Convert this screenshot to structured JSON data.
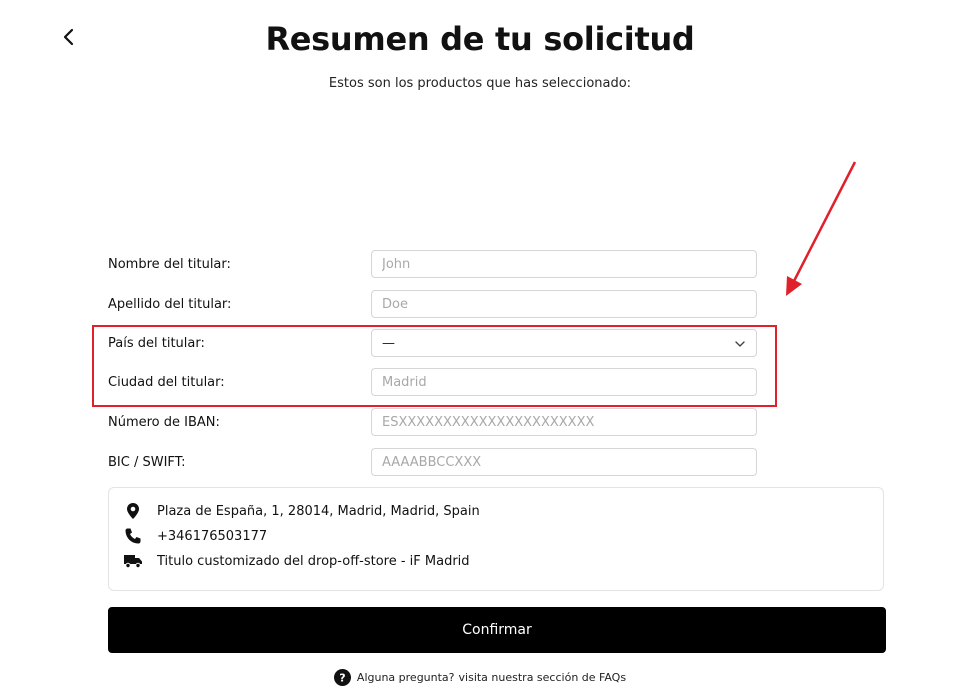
{
  "header": {
    "back_icon": "chevron-left-icon",
    "title": "Resumen de tu solicitud",
    "subtitle": "Estos son los productos que has seleccionado:"
  },
  "form": {
    "fields": [
      {
        "label": "Nombre del titular:",
        "placeholder": "John",
        "value": ""
      },
      {
        "label": "Apellido del titular:",
        "placeholder": "Doe",
        "value": ""
      },
      {
        "label": "País del titular:",
        "selected": "—",
        "icon": "chevron-down-icon"
      },
      {
        "label": "Ciudad del titular:",
        "placeholder": "Madrid",
        "value": ""
      },
      {
        "label": "Número de IBAN:",
        "placeholder": "ESXXXXXXXXXXXXXXXXXXXXXX",
        "value": ""
      },
      {
        "label": "BIC / SWIFT:",
        "placeholder": "AAAABBCCXXX",
        "value": ""
      }
    ]
  },
  "store": {
    "address": "Plaza de España, 1, 28014, Madrid, Madrid, Spain",
    "phone": "+346176503177",
    "name": "Titulo customizado del drop-off-store - iF Madrid",
    "icons": [
      "location-pin-icon",
      "phone-icon",
      "truck-icon"
    ]
  },
  "actions": {
    "confirm_label": "Confirmar"
  },
  "faq": {
    "question": "Alguna pregunta?",
    "link_text": "visita nuestra sección de FAQs"
  },
  "colors": {
    "highlight": "#e0202a",
    "button_bg": "#000000",
    "button_text": "#ffffff"
  }
}
